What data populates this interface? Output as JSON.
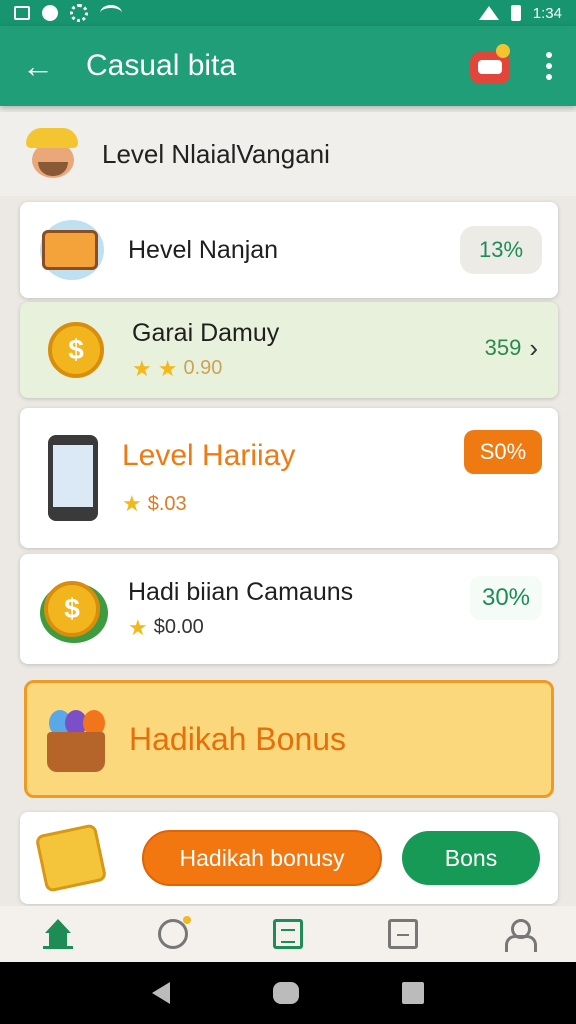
{
  "status_bar": {
    "time": "1:34"
  },
  "app_bar": {
    "back_glyph": "←",
    "title": "Casual bita"
  },
  "header": {
    "title": "Level NlaialVangani"
  },
  "cards": [
    {
      "title": "Hevel Nanjan",
      "badge": "13%"
    },
    {
      "title": "Garai Damuy",
      "rating": "0.90",
      "value": "359"
    },
    {
      "title": "Level Hariiay",
      "rating": "$.03",
      "badge": "S0%"
    },
    {
      "title": "Hadi biian Camauns",
      "rating": "$0.00",
      "badge": "30%"
    }
  ],
  "bonus_banner": {
    "title": "Hadikah Bonus"
  },
  "actions": {
    "primary_label": "Hadikah bonusy",
    "secondary_label": "Bons"
  },
  "icons": {
    "star": "★",
    "chevron": "›",
    "dollar": "$"
  },
  "colors": {
    "primary_green": "#1f9e78",
    "accent_orange": "#f07a12",
    "banner_yellow": "#fcd87c",
    "button_green": "#179a55"
  }
}
